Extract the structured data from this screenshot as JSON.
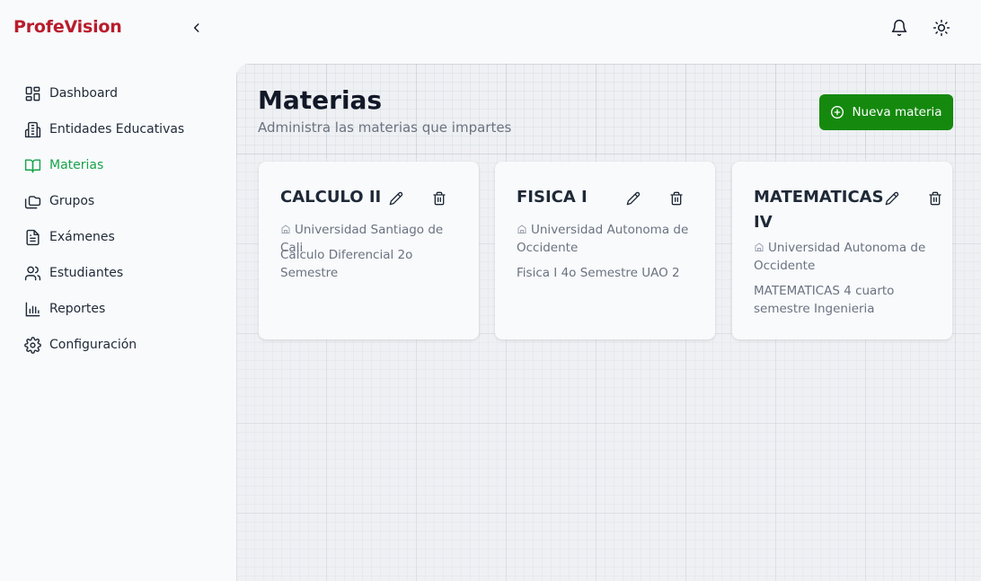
{
  "app": {
    "logo": "ProfeVision"
  },
  "header": {
    "icons": [
      "chevron-left-icon",
      "bell-icon",
      "sun-icon"
    ]
  },
  "sidebar": {
    "items": [
      {
        "label": "Dashboard",
        "icon": "dashboard-icon",
        "active": false
      },
      {
        "label": "Entidades Educativas",
        "icon": "building-icon",
        "active": false
      },
      {
        "label": "Materias",
        "icon": "book-open-icon",
        "active": true
      },
      {
        "label": "Grupos",
        "icon": "folders-icon",
        "active": false
      },
      {
        "label": "Exámenes",
        "icon": "file-text-icon",
        "active": false
      },
      {
        "label": "Estudiantes",
        "icon": "users-icon",
        "active": false
      },
      {
        "label": "Reportes",
        "icon": "bar-chart-icon",
        "active": false
      },
      {
        "label": "Configuración",
        "icon": "gear-icon",
        "active": false
      }
    ],
    "active_color": "#16a34a"
  },
  "main": {
    "title": "Materias",
    "subtitle": "Administra las materias que impartes",
    "new_button": "Nueva materia",
    "accent": "#15890e"
  },
  "cards": [
    {
      "title": "CALCULO II",
      "institution": "Universidad Santiago de Cali",
      "description": "Calculo Diferencial 2o Semestre"
    },
    {
      "title": "FISICA I",
      "institution": "Universidad Autonoma de Occidente",
      "description": "Fisica I 4o Semestre UAO 2"
    },
    {
      "title": "MATEMATICAS IV",
      "institution": "Universidad Autonoma de Occidente",
      "description": "MATEMATICAS 4 cuarto semestre Ingenieria"
    }
  ]
}
